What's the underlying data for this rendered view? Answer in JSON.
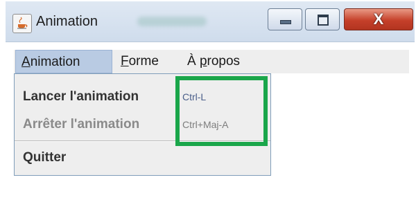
{
  "window": {
    "title": "Animation",
    "icons": {
      "app": "java-cup-icon",
      "minimize": "minimize-icon",
      "maximize": "maximize-icon",
      "close": "close-icon"
    },
    "close_glyph": "X"
  },
  "menubar": {
    "items": [
      {
        "label_prefix": "",
        "mnemonic": "A",
        "label_suffix": "nimation",
        "active": true
      },
      {
        "label_prefix": "",
        "mnemonic": "F",
        "label_suffix": "orme",
        "active": false
      },
      {
        "label_prefix": "À ",
        "mnemonic": "p",
        "label_suffix": "ropos",
        "active": false
      }
    ]
  },
  "dropdown": {
    "items": [
      {
        "label": "Lancer l'animation",
        "accelerator": "Ctrl-L",
        "enabled": true
      },
      {
        "label": "Arrêter l'animation",
        "accelerator": "Ctrl+Maj-A",
        "enabled": false
      },
      {
        "label": "Quitter",
        "accelerator": "",
        "enabled": true
      }
    ]
  },
  "colors": {
    "highlight": "#1aa64a",
    "menu_active": "#b9cbe3"
  }
}
